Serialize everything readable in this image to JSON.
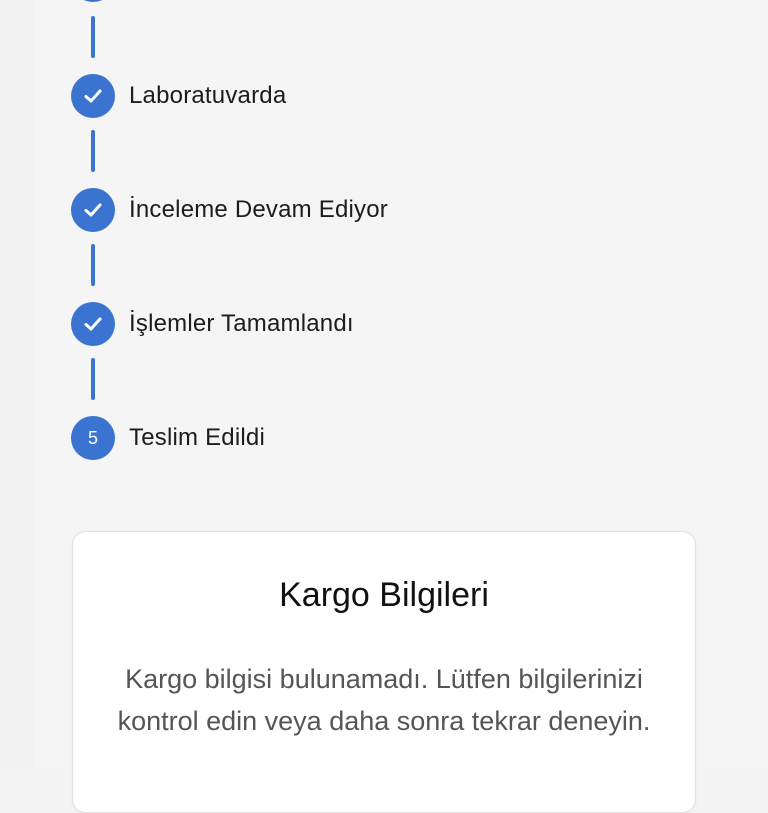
{
  "timeline": {
    "steps": [
      {
        "label": "",
        "state": "completed",
        "icon": "check-icon"
      },
      {
        "label": "Laboratuvarda",
        "state": "completed",
        "icon": "check-icon"
      },
      {
        "label": "İnceleme Devam Ediyor",
        "state": "completed",
        "icon": "check-icon"
      },
      {
        "label": "İşlemler Tamamlandı",
        "state": "completed",
        "icon": "check-icon"
      },
      {
        "label": "Teslim Edildi",
        "state": "pending",
        "number": "5"
      }
    ],
    "accent_color": "#3a74d0"
  },
  "cargo": {
    "title": "Kargo Bilgileri",
    "message": "Kargo bilgisi bulunamadı. Lütfen bilgilerinizi kontrol edin veya daha sonra tekrar deneyin."
  }
}
